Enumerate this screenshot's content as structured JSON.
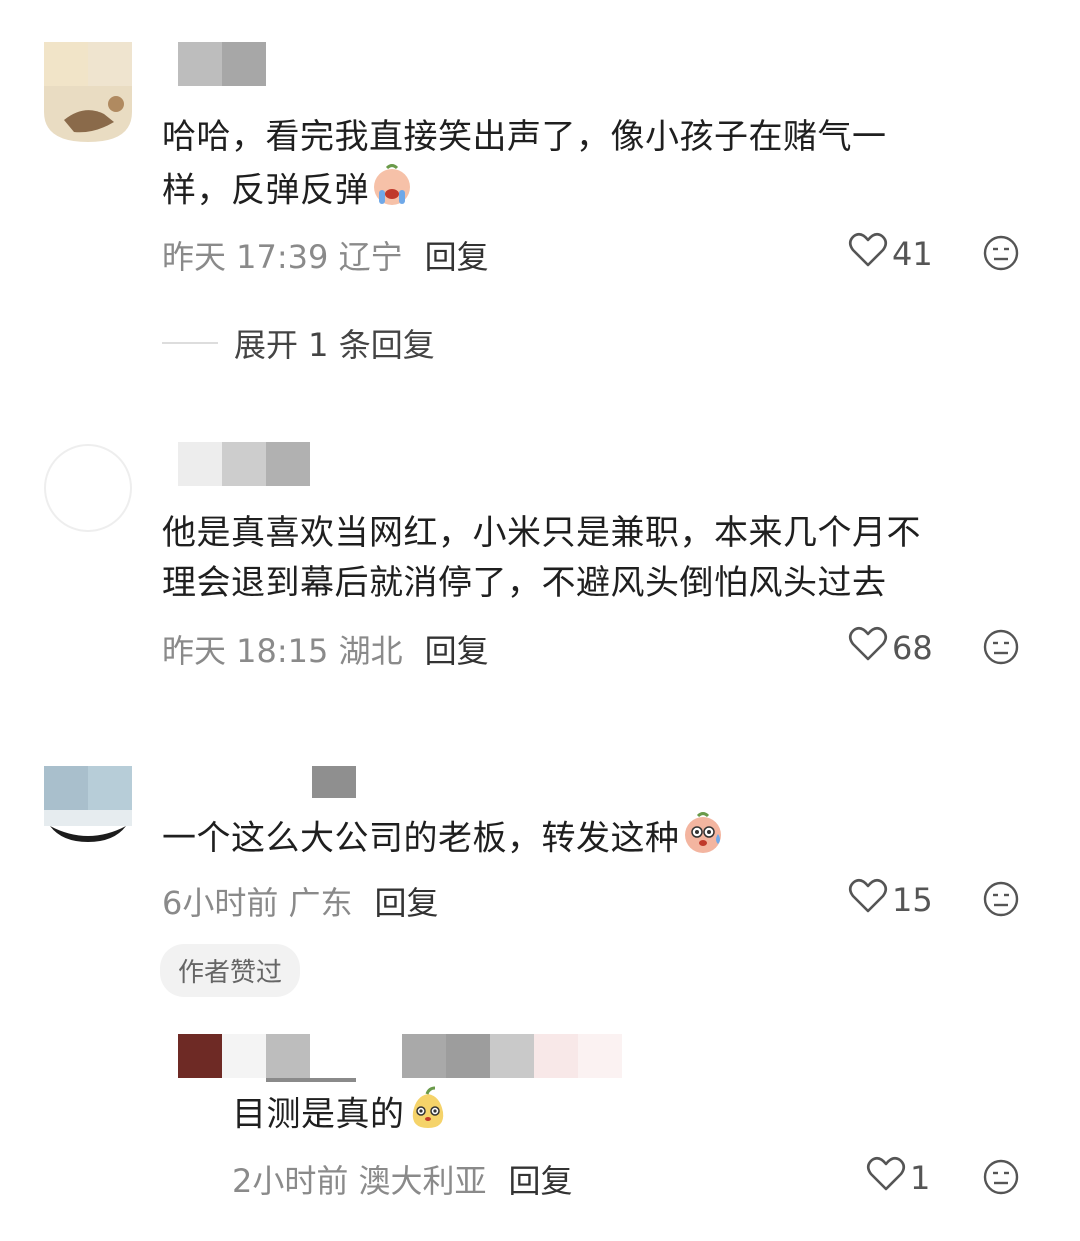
{
  "comments": [
    {
      "text_line1": "哈哈，看完我直接笑出声了，像小孩子在赌气一",
      "text_line2": "样，反弹反弹",
      "meta": "昨天 17:39 辽宁",
      "reply_label": "回复",
      "likes": "41",
      "expand_label": "展开 1 条回复"
    },
    {
      "text_line1": "他是真喜欢当网红，小米只是兼职，本来几个月不",
      "text_line2": "理会退到幕后就消停了，不避风头倒怕风头过去",
      "meta": "昨天 18:15 湖北",
      "reply_label": "回复",
      "likes": "68"
    },
    {
      "text": "一个这么大公司的老板，转发这种",
      "meta": "6小时前 广东",
      "reply_label": "回复",
      "likes": "15",
      "badge": "作者赞过"
    }
  ],
  "reply": {
    "text": "目测是真的",
    "meta": "2小时前 澳大利亚",
    "reply_label": "回复",
    "likes": "1"
  },
  "icons": {
    "like": "heart-outline-icon",
    "dislike": "neutral-face-icon"
  },
  "colors": {
    "text": "#1f1f1f",
    "meta": "#8a8a8a",
    "badge_bg": "#f2f2f2"
  }
}
